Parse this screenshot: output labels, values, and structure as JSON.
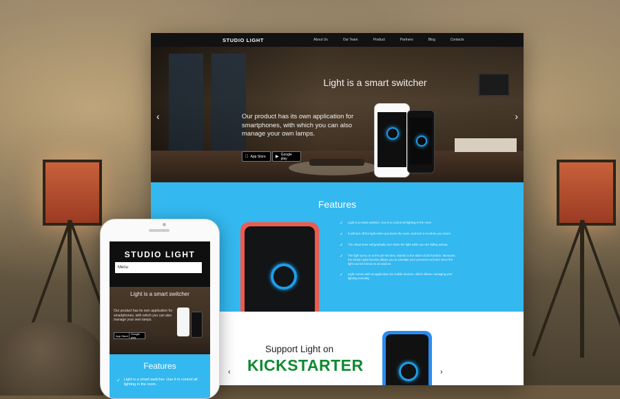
{
  "site": {
    "logo": "STUDIO LIGHT",
    "nav": [
      "About Us",
      "Our Team",
      "Product",
      "Partners",
      "Blog",
      "Contacts"
    ],
    "hero": {
      "title": "Light is a smart switcher",
      "text": "Our product has its own application for smartphones, with which you can also manage your own lamps.",
      "app_store": "App Store",
      "google_play": "Google play",
      "prev_arrow": "‹",
      "next_arrow": "›"
    },
    "features": {
      "title": "Features",
      "items": [
        "Light is a smart switcher. Use it to control all lighting in the room",
        "It will turn off the light when you leave the room, and turn it on when you return.",
        "The sleep timer will gradually turn down the light while you are falling asleep.",
        "The light turns on at the pre-set time, thanks to the alarm clock function. Moreover, the Smart Light function allows you to simulate your presence at home since the light can be turned on at anytime",
        "Light comes with an application for mobile devices, which allows managing your lighting remotely"
      ]
    },
    "kickstarter": {
      "support": "Support Light on",
      "brand": "KICKSTARTER",
      "prev_arrow": "‹",
      "next_arrow": "›"
    }
  },
  "mobile": {
    "logo": "STUDIO LIGHT",
    "menu": "Menu",
    "hero_title": "Light is a smart switcher",
    "hero_text": "Our product has its own application for smartphones, with which you can also manage your own lamps.",
    "features_title": "Features",
    "feature_item": "Light is a smart switcher. Use it to control all lighting in the room."
  },
  "colors": {
    "accent": "#33b8ef",
    "nav_bg": "#121212",
    "kickstarter_green": "#0e8a2f"
  }
}
